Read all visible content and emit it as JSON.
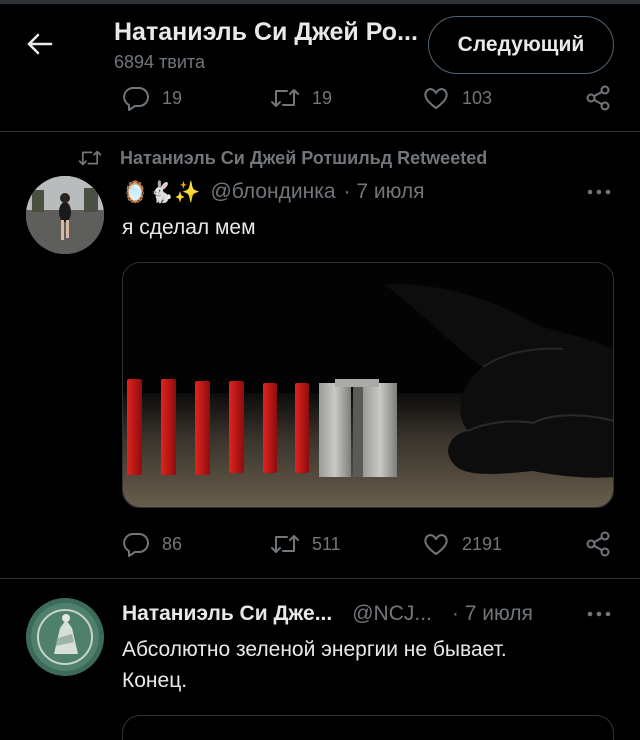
{
  "header": {
    "title": "Натаниэль Си Джей Ро...",
    "subtitle": "6894 твита",
    "follow_label": "Следующий"
  },
  "tweet_top": {
    "replies": "19",
    "retweets": "19",
    "likes": "103"
  },
  "retweet_banner": "Натаниэль Си Джей Ротшильд Retweeted",
  "tweet_meme": {
    "emojis": "🪞🐇✨",
    "handle": "@блондинка",
    "date": "· 7 июля",
    "text": "я сделал мем",
    "replies": "86",
    "retweets": "511",
    "likes": "2191"
  },
  "tweet_last": {
    "name": "Натаниэль Си Дже...",
    "handle": "@NCJ...",
    "date": "· 7 июля",
    "text_line1": "Абсолютно зеленой энергии не бывает.",
    "text_line2": "Конец."
  },
  "colors": {
    "background": "#000000",
    "text_primary": "#e7e9ea",
    "text_secondary": "#71767b",
    "divider": "#2f3336",
    "domino_red": "#d41a1a"
  },
  "icons": {
    "back": "arrow-left-icon",
    "reply": "reply-icon",
    "retweet": "retweet-icon",
    "like": "heart-icon",
    "share": "share-icon",
    "more": "more-dots-icon"
  }
}
